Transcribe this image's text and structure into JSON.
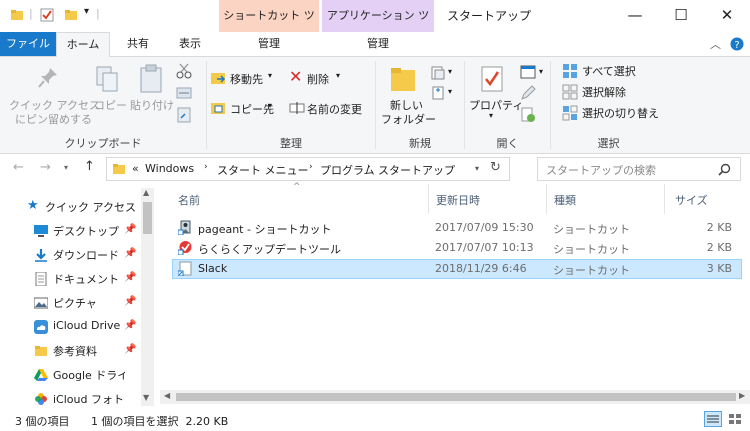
{
  "window": {
    "title": "スタートアップ",
    "context_tab_shortcut": "ショートカット ツール",
    "context_tab_app": "アプリケーション ツール",
    "context_shortcut_color": "#fbd4c3",
    "context_app_color": "#e4cff5"
  },
  "tabs": {
    "file": "ファイル",
    "home": "ホーム",
    "share": "共有",
    "view": "表示",
    "manage1": "管理",
    "manage2": "管理"
  },
  "ribbon": {
    "clipboard": {
      "pin_label_1": "クイック アクセス",
      "pin_label_2": "にピン留めする",
      "copy": "コピー",
      "paste": "貼り付け",
      "group": "クリップボード"
    },
    "organize": {
      "move_to": "移動先",
      "copy_to": "コピー先",
      "delete": "削除",
      "rename": "名前の変更",
      "group": "整理"
    },
    "new": {
      "new_folder_1": "新しい",
      "new_folder_2": "フォルダー",
      "group": "新規"
    },
    "open": {
      "properties": "プロパティ",
      "group": "開く"
    },
    "select": {
      "select_all": "すべて選択",
      "select_none": "選択解除",
      "invert": "選択の切り替え",
      "group": "選択"
    }
  },
  "address": {
    "prefix": "«",
    "path": [
      "Windows",
      "スタート メニュー",
      "プログラム",
      "スタートアップ"
    ],
    "search_placeholder": "スタートアップの検索"
  },
  "nav": {
    "items": [
      {
        "label": "クイック アクセス",
        "icon": "star-icon",
        "pinned": false
      },
      {
        "label": "デスクトップ",
        "icon": "desktop-icon",
        "pinned": true
      },
      {
        "label": "ダウンロード",
        "icon": "download-icon",
        "pinned": true
      },
      {
        "label": "ドキュメント",
        "icon": "document-icon",
        "pinned": true
      },
      {
        "label": "ピクチャ",
        "icon": "pictures-icon",
        "pinned": true
      },
      {
        "label": "iCloud Drive",
        "icon": "icloud-icon",
        "pinned": true
      },
      {
        "label": "参考資料",
        "icon": "folder-icon",
        "pinned": true
      },
      {
        "label": "Google ドライブ",
        "icon": "google-drive-icon",
        "pinned": false
      },
      {
        "label": "iCloud フォト",
        "icon": "icloud-photos-icon",
        "pinned": false
      }
    ]
  },
  "columns": {
    "name": "名前",
    "date": "更新日時",
    "type": "種類",
    "size": "サイズ"
  },
  "files": [
    {
      "name": "pageant - ショートカット",
      "date": "2017/07/09 15:30",
      "type": "ショートカット",
      "size": "2 KB",
      "icon": "pageant-icon",
      "selected": false
    },
    {
      "name": "らくらくアップデートツール",
      "date": "2017/07/07 10:13",
      "type": "ショートカット",
      "size": "2 KB",
      "icon": "update-tool-icon",
      "selected": false
    },
    {
      "name": "Slack",
      "date": "2018/11/29 6:46",
      "type": "ショートカット",
      "size": "3 KB",
      "icon": "slack-shortcut-icon",
      "selected": true
    }
  ],
  "status": {
    "count": "3 個の項目",
    "selection": "1 個の項目を選択  2.20 KB"
  },
  "colors": {
    "accent": "#1979ca",
    "selection_bg": "#cce8ff",
    "selection_border": "#99d1ff"
  }
}
